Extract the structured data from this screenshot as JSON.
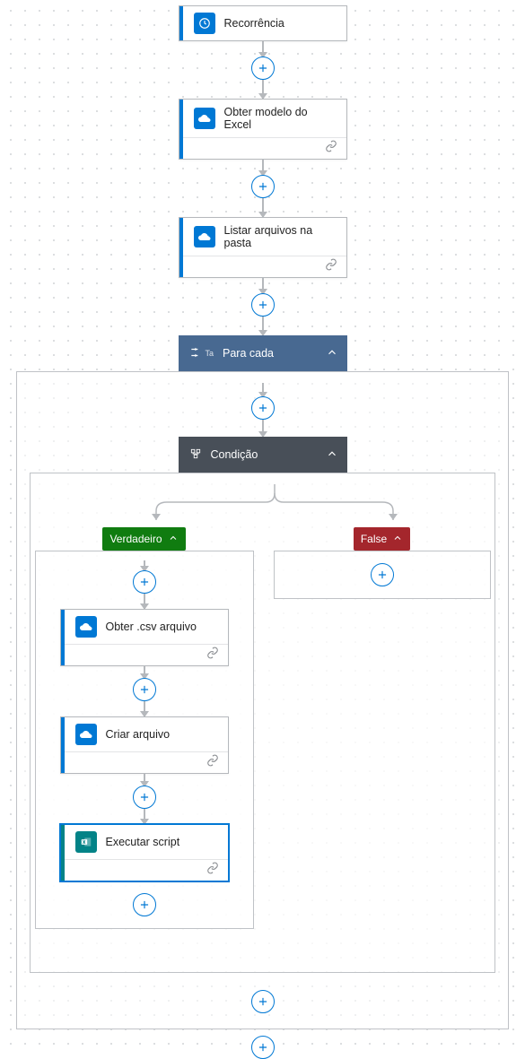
{
  "colors": {
    "primary": "#0078d4",
    "foreach": "#486991",
    "condition": "#484F58",
    "true_branch": "#107C10",
    "false_branch": "#A4262C",
    "excel": "#038387"
  },
  "cards": {
    "trigger": {
      "label": "Recorrência",
      "icon": "clock-icon"
    },
    "step1": {
      "label": "Obter modelo do Excel",
      "icon": "onedrive-icon"
    },
    "step2": {
      "label": "Listar arquivos na pasta",
      "icon": "onedrive-icon"
    },
    "step3": {
      "label": "Obter .csv arquivo",
      "icon": "onedrive-icon"
    },
    "step4": {
      "label": "Criar arquivo",
      "icon": "onedrive-icon"
    },
    "step5": {
      "label": "Executar script",
      "icon": "excel-icon"
    }
  },
  "controls": {
    "foreach": {
      "label": "Para cada",
      "icon": "control-icon"
    },
    "condition": {
      "label": "Condição",
      "icon": "condition-icon"
    }
  },
  "branches": {
    "true_label": "Verdadeiro",
    "false_label": "False"
  }
}
